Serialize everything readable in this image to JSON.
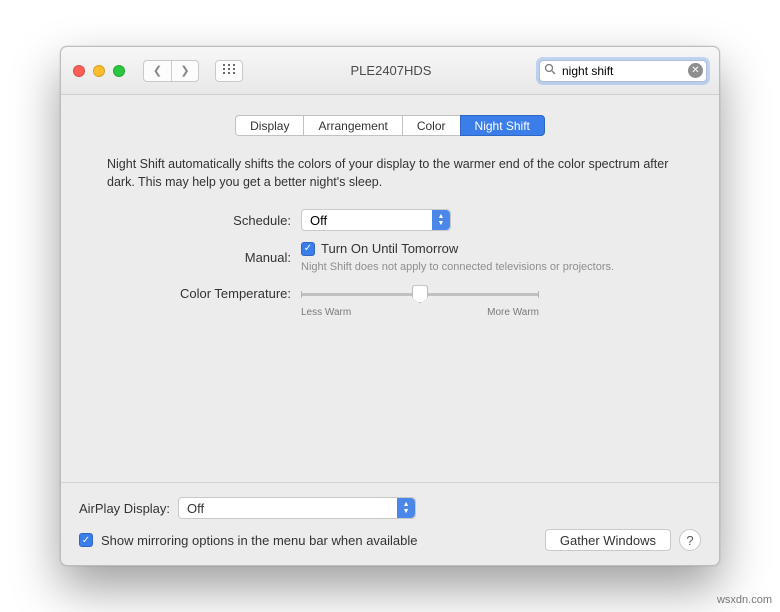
{
  "window": {
    "title": "PLE2407HDS",
    "search_value": "night shift",
    "search_placeholder": "Search"
  },
  "tabs": [
    {
      "label": "Display"
    },
    {
      "label": "Arrangement"
    },
    {
      "label": "Color"
    },
    {
      "label": "Night Shift",
      "active": true
    }
  ],
  "description": "Night Shift automatically shifts the colors of your display to the warmer end of the color spectrum after dark. This may help you get a better night's sleep.",
  "schedule": {
    "label": "Schedule:",
    "value": "Off"
  },
  "manual": {
    "label": "Manual:",
    "checkbox_label": "Turn On Until Tomorrow",
    "checked": true,
    "hint": "Night Shift does not apply to connected televisions or projectors."
  },
  "color_temperature": {
    "label": "Color Temperature:",
    "min_label": "Less Warm",
    "max_label": "More Warm",
    "value": 50
  },
  "airplay": {
    "label": "AirPlay Display:",
    "value": "Off"
  },
  "mirroring": {
    "label": "Show mirroring options in the menu bar when available",
    "checked": true
  },
  "gather_windows": "Gather Windows",
  "watermark": "wsxdn.com"
}
